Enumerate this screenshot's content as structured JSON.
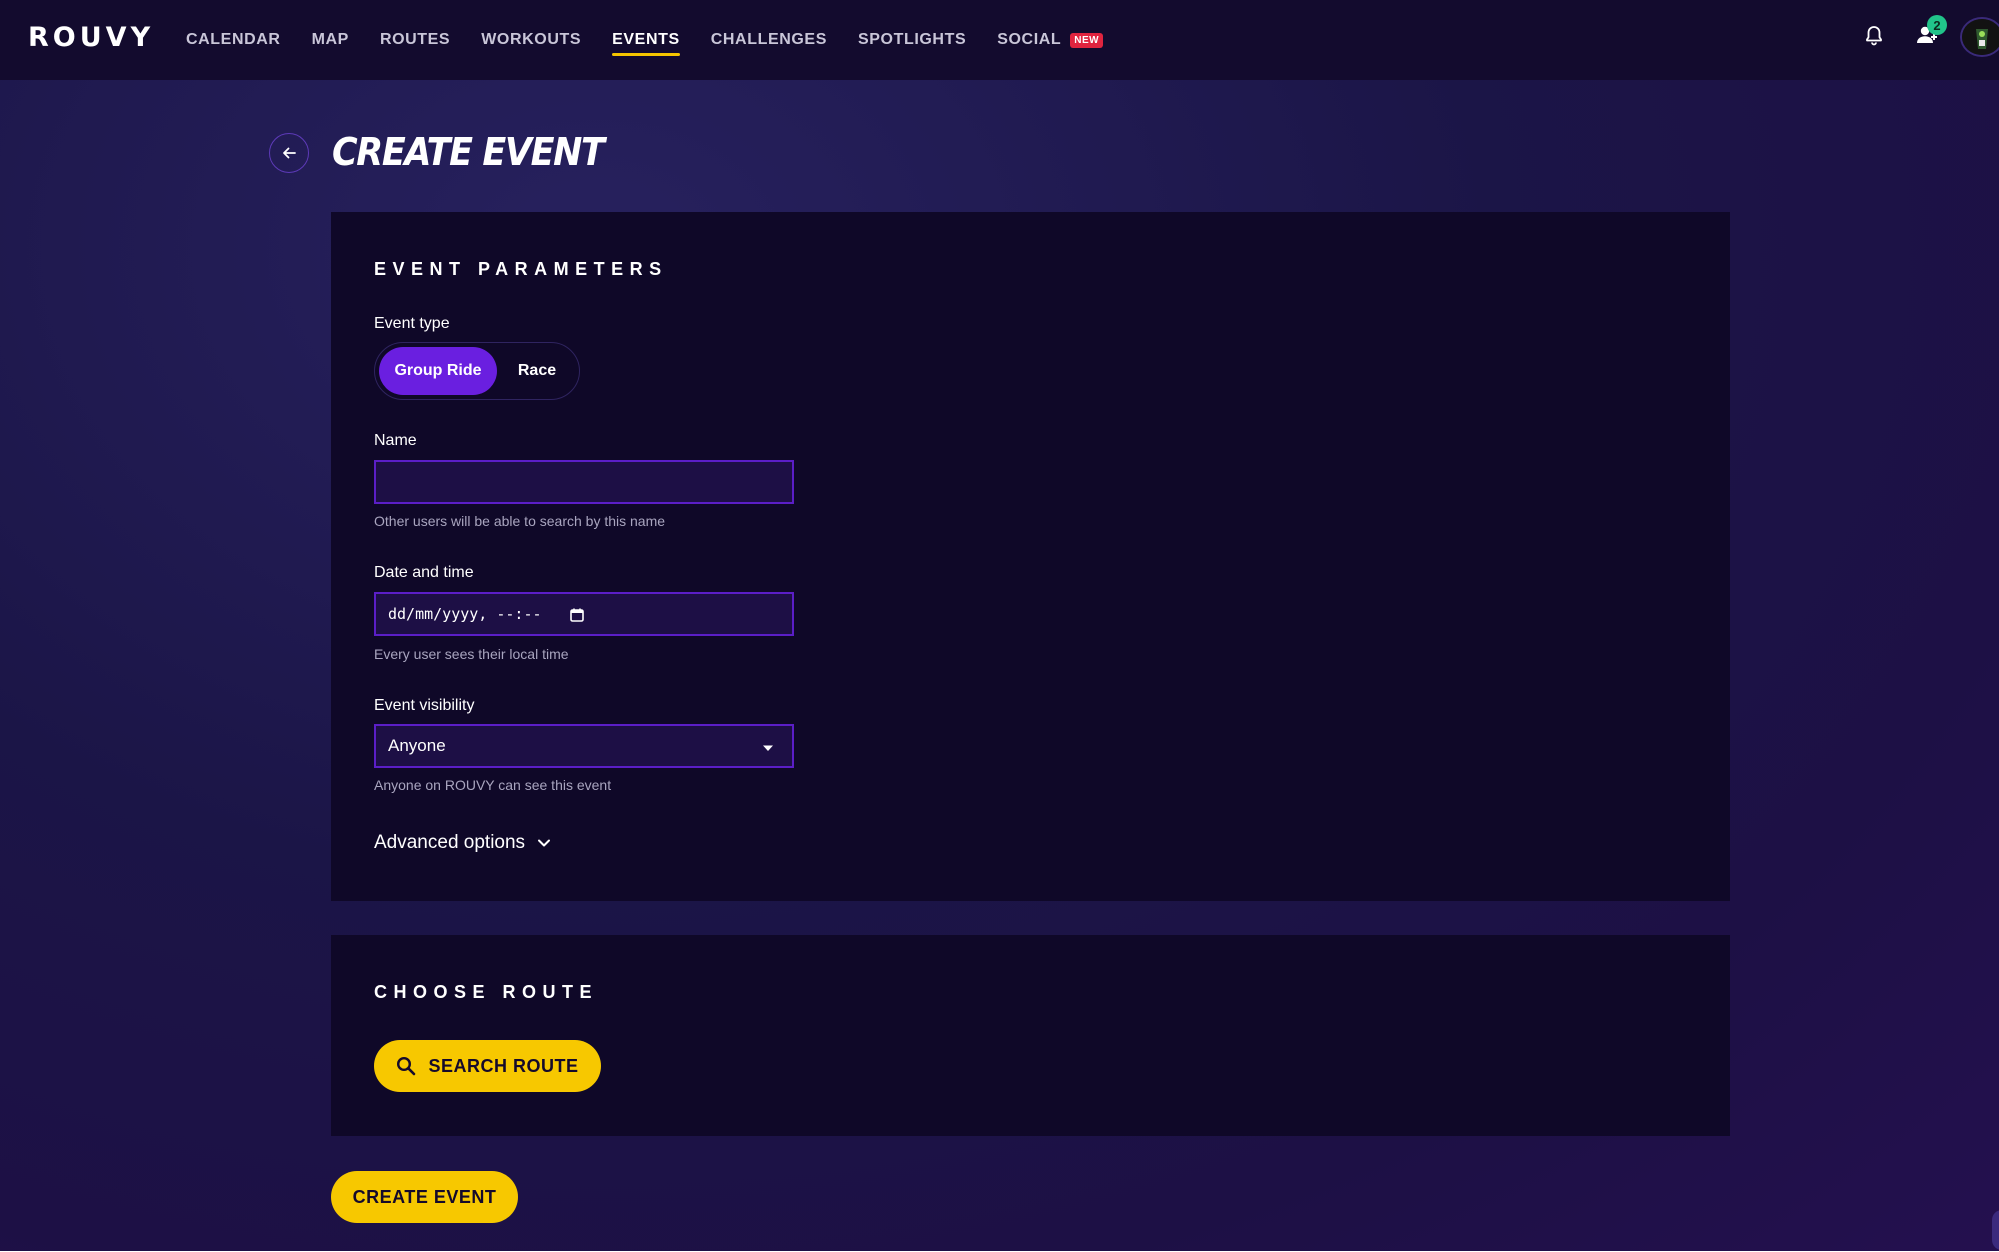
{
  "brand": {
    "logo_text": "ROUVY"
  },
  "nav": {
    "items": [
      {
        "label": "CALENDAR"
      },
      {
        "label": "MAP"
      },
      {
        "label": "ROUTES"
      },
      {
        "label": "WORKOUTS"
      },
      {
        "label": "EVENTS"
      },
      {
        "label": "CHALLENGES"
      },
      {
        "label": "SPOTLIGHTS"
      },
      {
        "label": "SOCIAL"
      }
    ],
    "active": "EVENTS",
    "social_badge": "NEW",
    "friends_count": "2"
  },
  "page": {
    "title": "CREATE EVENT"
  },
  "params": {
    "heading": "EVENT PARAMETERS",
    "event_type_label": "Event type",
    "event_type_options": [
      "Group Ride",
      "Race"
    ],
    "event_type_selected": "Group Ride",
    "name_label": "Name",
    "name_value": "",
    "name_help": "Other users will be able to search by this name",
    "datetime_label": "Date and time",
    "datetime_value": "dd/mm/yyyy, --:--",
    "datetime_help": "Every user sees their local time",
    "visibility_label": "Event visibility",
    "visibility_value": "Anyone",
    "visibility_help": "Anyone on ROUVY can see this event",
    "advanced_label": "Advanced options"
  },
  "route": {
    "heading": "CHOOSE ROUTE",
    "search_label": "SEARCH ROUTE"
  },
  "actions": {
    "create_label": "CREATE EVENT"
  },
  "colors": {
    "accent_yellow": "#f7c800",
    "accent_purple": "#6a1fe0",
    "badge_red": "#e0243f",
    "badge_green": "#21c48a"
  },
  "icons": [
    "bell-icon",
    "friends-icon",
    "back-arrow-icon",
    "calendar-icon",
    "caret-down-icon",
    "chevron-down-icon",
    "search-icon"
  ]
}
